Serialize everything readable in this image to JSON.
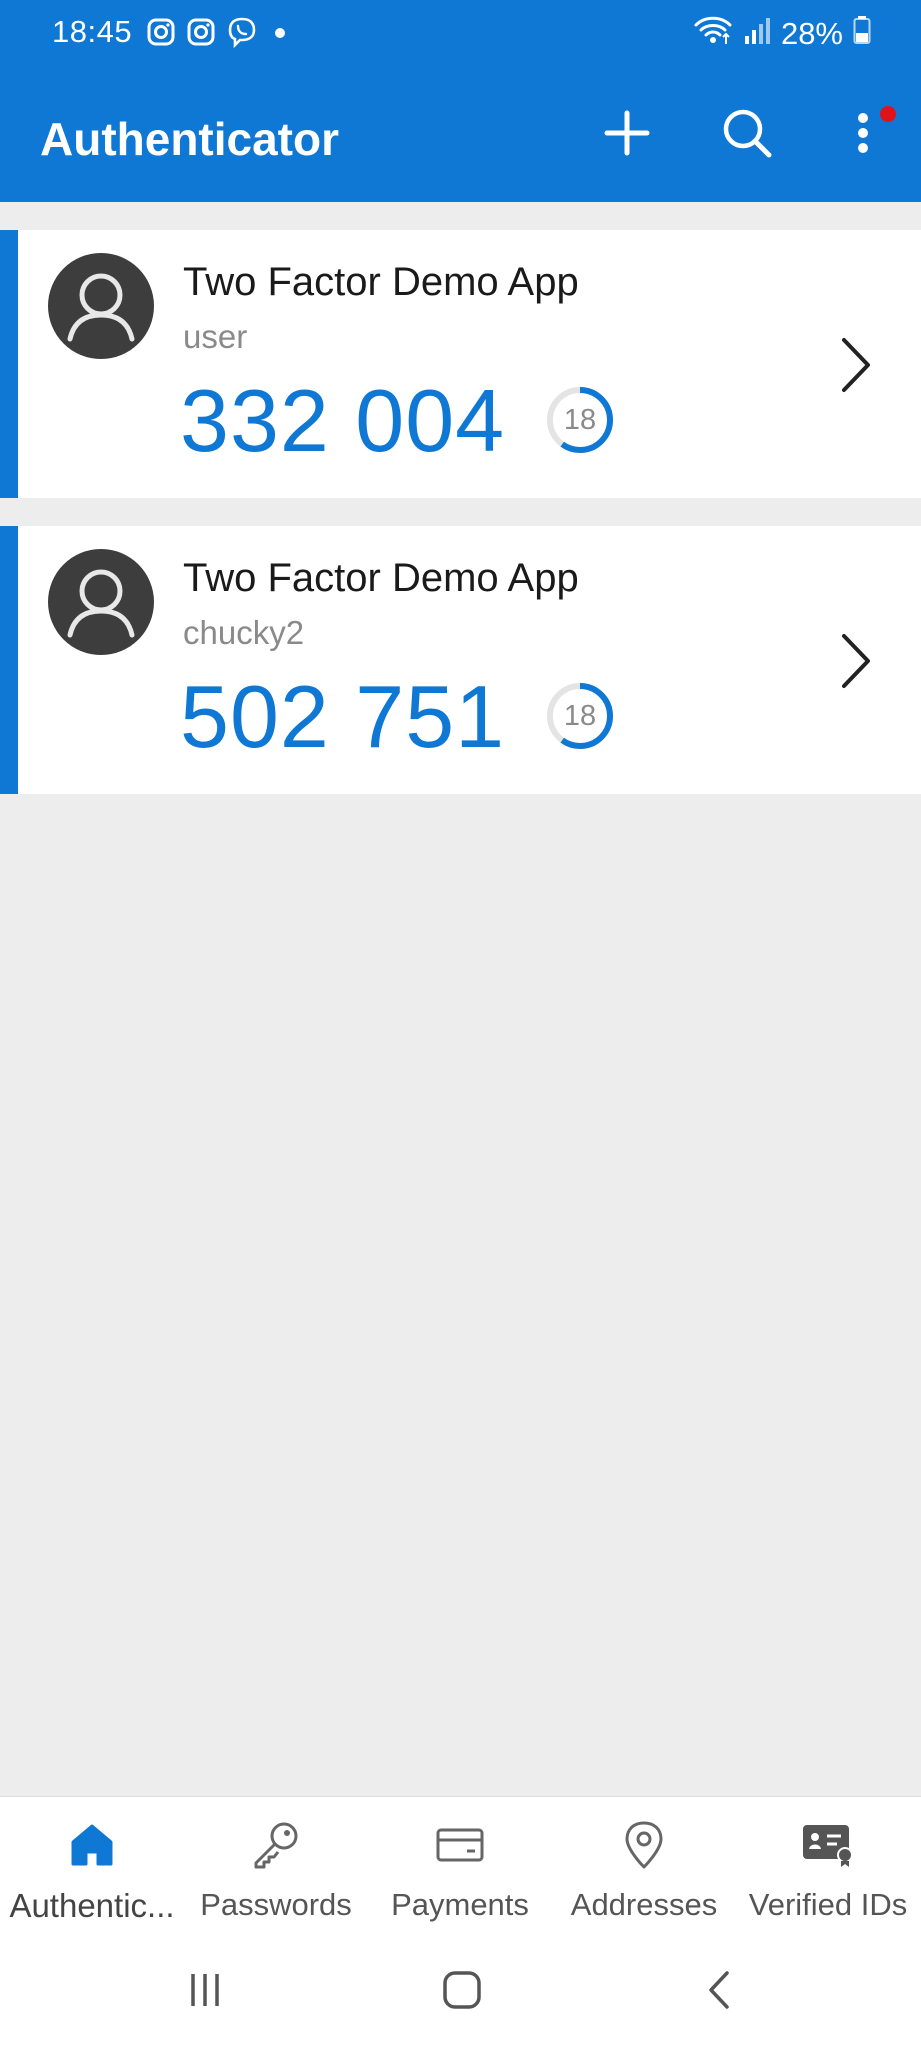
{
  "status_bar": {
    "time": "18:45",
    "battery": "28%",
    "icons": [
      "instagram-icon",
      "instagram-icon",
      "viber-icon",
      "notification-dot-icon",
      "wifi-icon",
      "signal-icon",
      "battery-icon"
    ]
  },
  "header": {
    "title": "Authenticator",
    "actions": [
      "add-icon",
      "search-icon",
      "more-icon"
    ]
  },
  "accounts": [
    {
      "app": "Two Factor Demo App",
      "user": "user",
      "code": "332 004",
      "timer": "18",
      "timer_fraction": 0.6
    },
    {
      "app": "Two Factor Demo App",
      "user": "chucky2",
      "code": "502 751",
      "timer": "18",
      "timer_fraction": 0.6
    }
  ],
  "bottom_nav": {
    "items": [
      {
        "label": "Authentic...",
        "icon": "home-icon",
        "active": true
      },
      {
        "label": "Passwords",
        "icon": "key-icon",
        "active": false
      },
      {
        "label": "Payments",
        "icon": "card-icon",
        "active": false
      },
      {
        "label": "Addresses",
        "icon": "location-icon",
        "active": false
      },
      {
        "label": "Verified IDs",
        "icon": "id-card-icon",
        "active": false
      }
    ]
  },
  "colors": {
    "brand": "#0f78d4",
    "background": "#ededed",
    "code_text": "#0f78d4",
    "notification": "#e0121b"
  }
}
